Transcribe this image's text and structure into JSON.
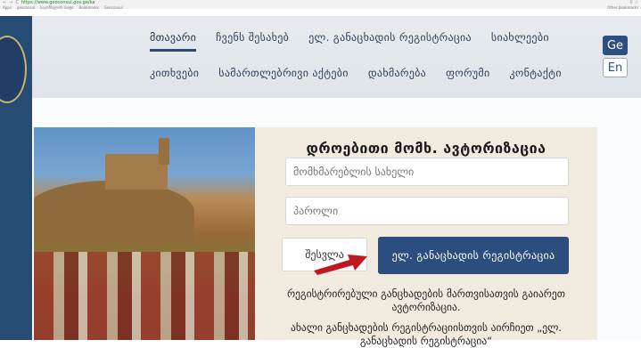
{
  "browser": {
    "url": "https://www.geoconsul.gov.ge/ka",
    "bookmarks": [
      "Apps",
      "geoconsul",
      "საკონსულოს საიტი",
      "Bookmarks",
      "Geoconsul"
    ],
    "other_bookmarks": "Other bookmarks"
  },
  "menu": {
    "row1": [
      "მთავარი",
      "ჩვენს შესახებ",
      "ელ. განაცხადის რეგისტრაცია",
      "სიახლეები"
    ],
    "row2": [
      "კითხვები",
      "სამართლებრივი აქტები",
      "დახმარება",
      "ფორუმი",
      "კონტაქტი"
    ],
    "active_index": 0
  },
  "lang": {
    "ge": "Ge",
    "en": "En",
    "active": "ge"
  },
  "login": {
    "title": "დროებითი მომხ. ავტორიზაცია",
    "username_placeholder": "მომხმარებლის სახელი",
    "password_placeholder": "პაროლი",
    "login_button": "შესვლა",
    "register_button": "ელ. განაცხადის რეგისტრაცია",
    "note1": "რეგისტრირებული განცხადების მართვისათვის გაიარეთ ავტორიზაცია.",
    "note2": "ახალი განცხადების რეგისტრაციისთვის აირჩიეთ „ელ. განაცხადის რეგისტრაცია“"
  },
  "colors": {
    "accent": "#2b4e7f",
    "arrow": "#c0181e"
  }
}
